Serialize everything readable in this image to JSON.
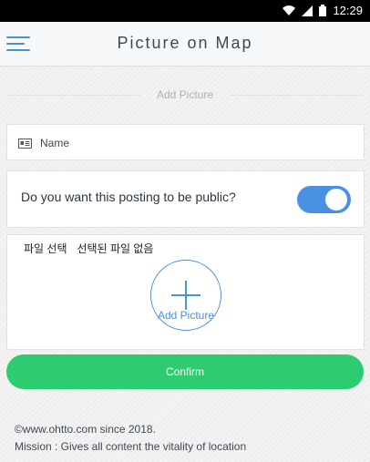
{
  "status_bar": {
    "time": "12:29",
    "icons": [
      "wifi-icon",
      "signal-icon",
      "battery-icon"
    ]
  },
  "header": {
    "title": "Picture on Map",
    "menu_icon": "hamburger-menu-icon"
  },
  "form": {
    "section_label": "Add Picture",
    "name_placeholder": "Name",
    "name_icon": "id-card-icon",
    "public_question": "Do you want this posting to be public?",
    "public_toggle_on": true,
    "file_button_label": "파일 선택",
    "file_status": "선택된 파일 없음",
    "add_picture_label": "Add Picture",
    "confirm_label": "Confirm"
  },
  "footer": {
    "copyright": "©www.ohtto.com since 2018.",
    "mission": "Mission : Gives all content the vitality of location"
  },
  "colors": {
    "accent": "#4a90e2",
    "confirm": "#2ecc71",
    "text": "#3d4a55"
  }
}
